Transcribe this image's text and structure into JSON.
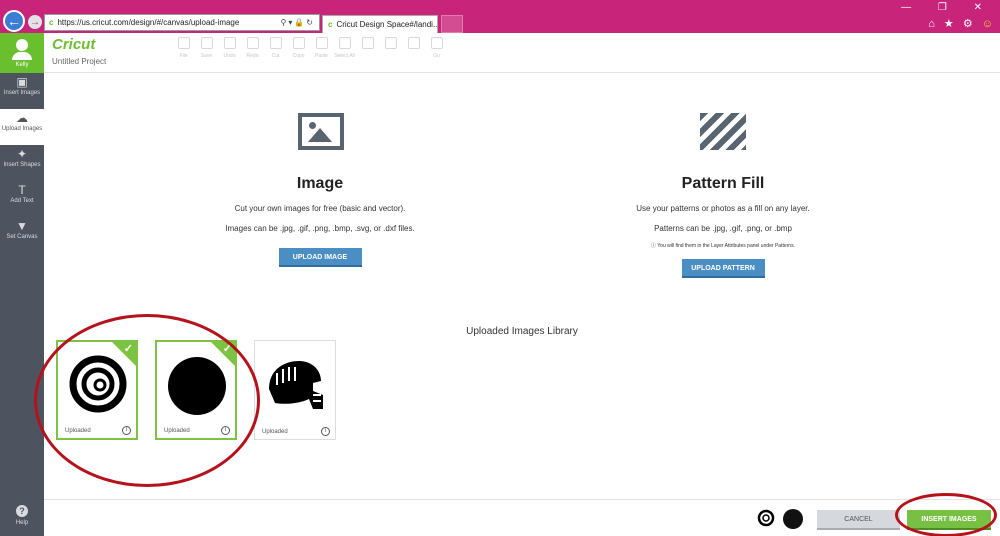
{
  "browser": {
    "url": "https://us.cricut.com/design/#/canvas/upload-image",
    "tab_title": "Cricut Design Space#/landi...",
    "tab_close": "×",
    "back": "←",
    "forward": "→",
    "window_controls": "— ❐ ✕",
    "toolbar_icons": "⌂ ★ ⚙",
    "smiley": "☺"
  },
  "header": {
    "user_name": "Kelly",
    "logo": "Cricut",
    "project_title": "Untitled Project",
    "toolbar": [
      "File",
      "Save",
      "Undo",
      "Redo",
      "Cut",
      "Copy",
      "Paste",
      "Select All",
      "",
      "",
      "",
      "Go"
    ]
  },
  "sidebar": {
    "items": [
      {
        "label": "Insert Images",
        "icon": "image-icon",
        "glyph": "▣"
      },
      {
        "label": "Upload Images",
        "icon": "cloud-upload-icon",
        "glyph": "☁"
      },
      {
        "label": "Insert Shapes",
        "icon": "shapes-icon",
        "glyph": "✦"
      },
      {
        "label": "Add Text",
        "icon": "text-icon",
        "glyph": "T"
      },
      {
        "label": "Set Canvas",
        "icon": "tshirt-icon",
        "glyph": "▼"
      }
    ],
    "help": "Help",
    "help_glyph": "?"
  },
  "image_panel": {
    "title": "Image",
    "line1": "Cut your own images for free (basic and vector).",
    "line2": "Images can be .jpg, .gif, .png, .bmp, .svg, or .dxf files.",
    "button": "UPLOAD IMAGE"
  },
  "pattern_panel": {
    "title": "Pattern Fill",
    "line1": "Use your patterns or photos as a fill on any layer.",
    "line2": "Patterns can be .jpg, .gif, .png, or .bmp",
    "note": "ⓘ You will find them in the Layer Attributes panel under Patterns.",
    "button": "UPLOAD PATTERN"
  },
  "library": {
    "title": "Uploaded Images Library",
    "cards": [
      {
        "caption": "Uploaded",
        "selected": true,
        "art": "swirl-image"
      },
      {
        "caption": "Uploaded",
        "selected": true,
        "art": "circle-image"
      },
      {
        "caption": "Uploaded",
        "selected": false,
        "art": "helmet-image"
      }
    ],
    "check": "✓",
    "info": "i"
  },
  "footer": {
    "cancel": "CANCEL",
    "insert": "INSERT IMAGES"
  },
  "colors": {
    "browser_bar": "#c8247a",
    "brand_green": "#6abf2f",
    "sidebar": "#4e5360",
    "button_blue": "#4b8ec3",
    "annotation_red": "#b5121b"
  }
}
